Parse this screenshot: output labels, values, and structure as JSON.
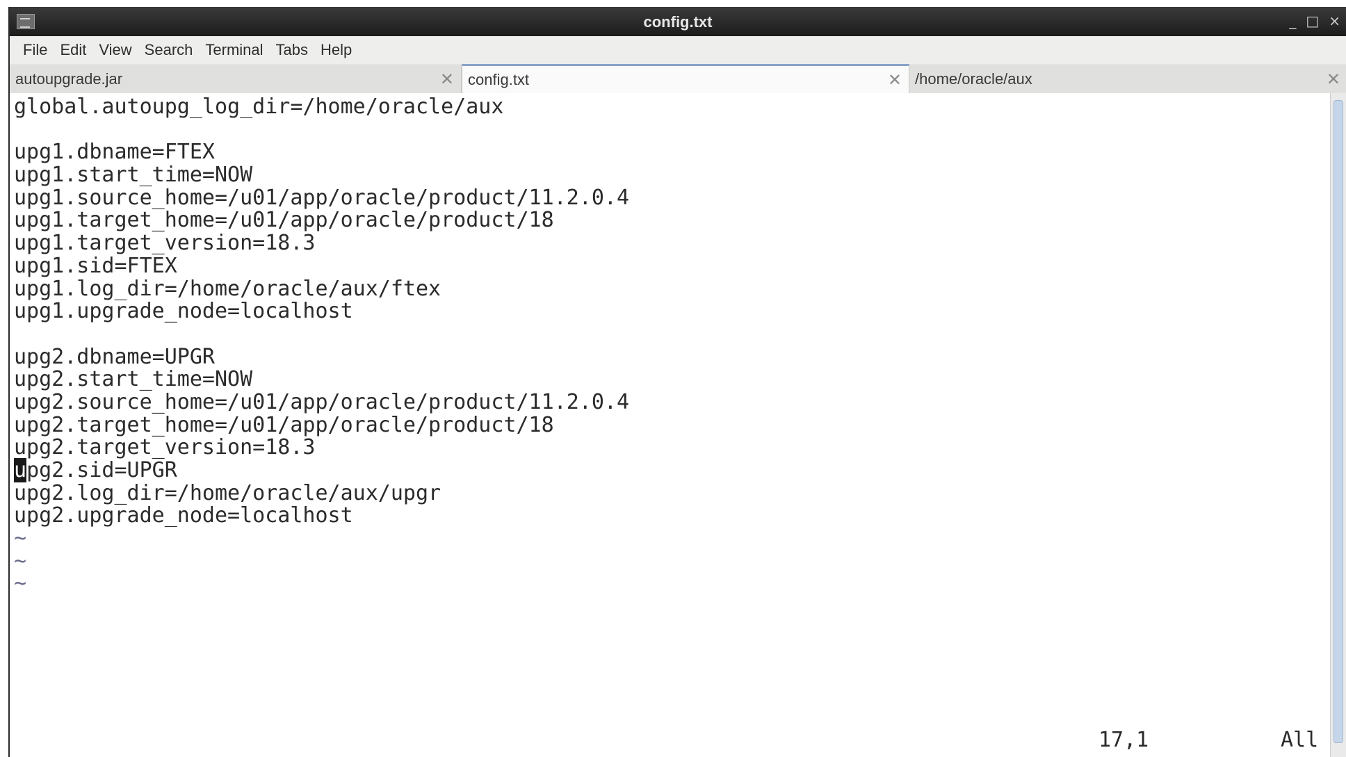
{
  "window": {
    "title": "config.txt"
  },
  "window_buttons": {
    "minimize": "_",
    "maximize": "□",
    "close": "×"
  },
  "menu": [
    "File",
    "Edit",
    "View",
    "Search",
    "Terminal",
    "Tabs",
    "Help"
  ],
  "tabs": [
    {
      "label": "autoupgrade.jar",
      "active": false
    },
    {
      "label": "config.txt",
      "active": true
    },
    {
      "label": "/home/oracle/aux",
      "active": false
    }
  ],
  "editor": {
    "lines": [
      "global.autoupg_log_dir=/home/oracle/aux",
      "",
      "upg1.dbname=FTEX",
      "upg1.start_time=NOW",
      "upg1.source_home=/u01/app/oracle/product/11.2.0.4",
      "upg1.target_home=/u01/app/oracle/product/18",
      "upg1.target_version=18.3",
      "upg1.sid=FTEX",
      "upg1.log_dir=/home/oracle/aux/ftex",
      "upg1.upgrade_node=localhost",
      "",
      "upg2.dbname=UPGR",
      "upg2.start_time=NOW",
      "upg2.source_home=/u01/app/oracle/product/11.2.0.4",
      "upg2.target_home=/u01/app/oracle/product/18",
      "upg2.target_version=18.3",
      "upg2.sid=UPGR",
      "upg2.log_dir=/home/oracle/aux/upgr",
      "upg2.upgrade_node=localhost"
    ],
    "cursor_line": 17,
    "tilde_lines": [
      "~",
      "~",
      "~"
    ],
    "status_position": "17,1",
    "status_scroll": "All"
  },
  "colors": {
    "titlebar": "#1c1c1c",
    "menubar": "#eeeeec",
    "active_tab_border": "#8aa3c7"
  }
}
